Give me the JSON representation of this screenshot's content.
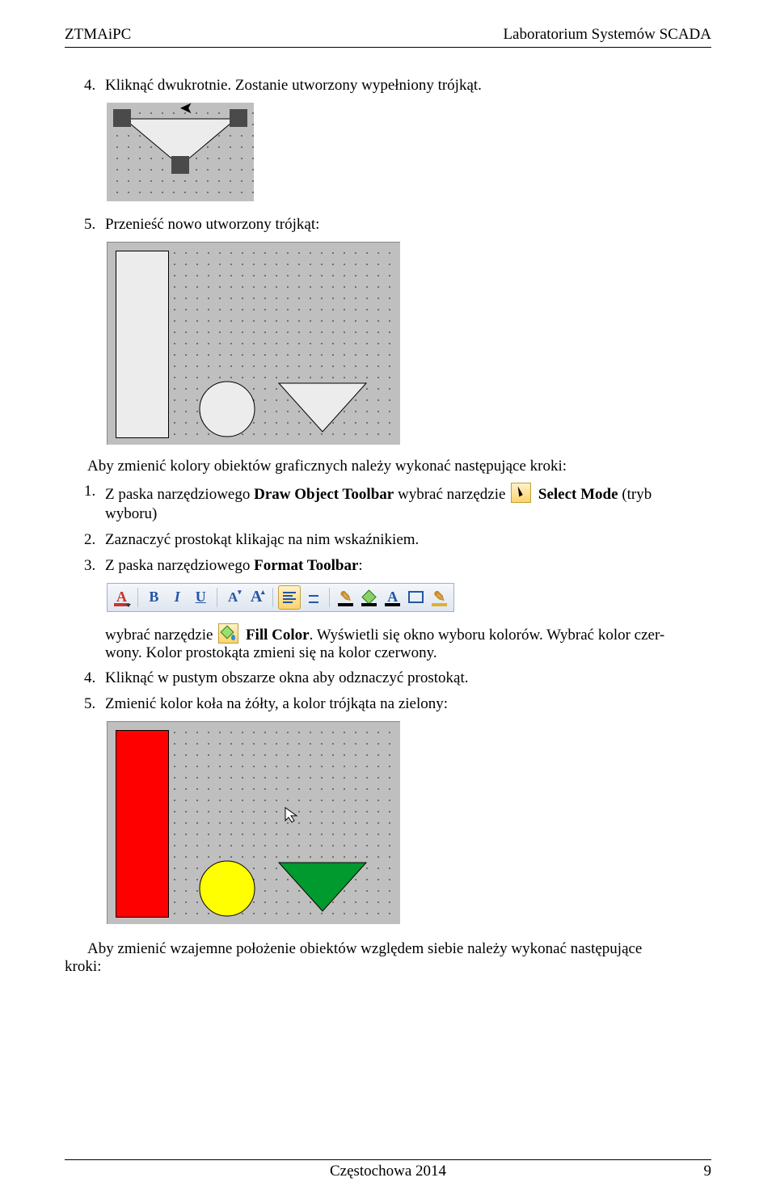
{
  "header": {
    "left": "ZTMAiPC",
    "right": "Laboratorium Systemów SCADA"
  },
  "steps_a": {
    "s4": {
      "num": "4.",
      "text": "Kliknąć dwukrotnie. Zostanie utworzony wypełniony trójkąt."
    },
    "s5": {
      "num": "5.",
      "text": "Przenieść nowo utworzony trójkąt:"
    }
  },
  "para1": "Aby zmienić kolory obiektów graficznych należy wykonać następujące kroki:",
  "steps_b": {
    "s1": {
      "num": "1.",
      "pre": "Z paska narzędziowego ",
      "bold1": "Draw Object Toolbar",
      "mid": " wybrać narzędzie ",
      "bold2": "Select Mode",
      "post_line": " (tryb",
      "line2": "wyboru)"
    },
    "s2": {
      "num": "2.",
      "text": "Zaznaczyć prostokąt klikając na nim wskaźnikiem."
    },
    "s3": {
      "num": "3.",
      "pre": "Z paska narzędziowego ",
      "bold": "Format Toolbar",
      "post": ":"
    },
    "s3b": {
      "pre": "wybrać narzędzie ",
      "bold1": "Fill Color",
      "post": ". Wyświetli się okno wyboru kolorów. Wybrać kolor czer-",
      "line2": "wony. Kolor prostokąta zmieni się na kolor czerwony."
    },
    "s4": {
      "num": "4.",
      "text": "Kliknąć w pustym obszarze okna aby odznaczyć prostokąt."
    },
    "s5": {
      "num": "5.",
      "text": "Zmienić kolor koła na żółty, a kolor trójkąta na zielony:"
    }
  },
  "para2_a": "Aby zmienić wzajemne położenie obiektów względem siebie należy wykonać następujące",
  "para2_b": "kroki:",
  "toolbar": {
    "A": "A",
    "B": "B",
    "I": "I",
    "U": "U",
    "Af": "A",
    "Af2": "A"
  },
  "footer": {
    "center": "Częstochowa 2014",
    "right": "9"
  }
}
